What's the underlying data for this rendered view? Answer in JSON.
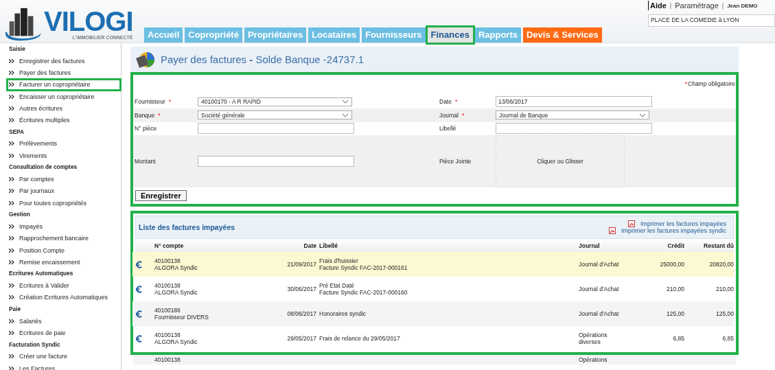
{
  "header": {
    "logo": {
      "name": "VILOGI",
      "tagline": "L'IMMOBILIER CONNECTÉ"
    },
    "links": [
      "Aide",
      "Paramétrage",
      "Jean DEMO"
    ],
    "link_separator": "|",
    "copro_field": {
      "value": "PLACE DE LA COMEDIE à LYON"
    },
    "tabs": [
      {
        "label": "Accueil",
        "kind": "normal",
        "selected": false,
        "highlighted": false
      },
      {
        "label": "Copropriété",
        "kind": "normal",
        "selected": false,
        "highlighted": false
      },
      {
        "label": "Propriétaires",
        "kind": "normal",
        "selected": false,
        "highlighted": false
      },
      {
        "label": "Locataires",
        "kind": "normal",
        "selected": false,
        "highlighted": false
      },
      {
        "label": "Fournisseurs",
        "kind": "normal",
        "selected": false,
        "highlighted": false
      },
      {
        "label": "Finances",
        "kind": "normal",
        "selected": true,
        "highlighted": true
      },
      {
        "label": "Rapports",
        "kind": "normal",
        "selected": false,
        "highlighted": false
      },
      {
        "label": "Devis & Services",
        "kind": "promo",
        "selected": false,
        "highlighted": false
      }
    ]
  },
  "sidebar": [
    {
      "title": "Saisie",
      "items": [
        {
          "label": "Enregistrer des factures",
          "highlighted": false
        },
        {
          "label": "Payer des factures",
          "highlighted": false
        },
        {
          "label": "Facturer un copropriétaire",
          "highlighted": true
        },
        {
          "label": "Encaisser un copropriétaire",
          "highlighted": false
        },
        {
          "label": "Autres écritures",
          "highlighted": false
        },
        {
          "label": "Écritures multiples",
          "highlighted": false
        }
      ]
    },
    {
      "title": "SEPA",
      "items": [
        {
          "label": "Prélèvements",
          "highlighted": false
        },
        {
          "label": "Virements",
          "highlighted": false
        }
      ]
    },
    {
      "title": "Consultation de comptes",
      "items": [
        {
          "label": "Par comptes",
          "highlighted": false
        },
        {
          "label": "Par journaux",
          "highlighted": false
        },
        {
          "label": "Pour toutes copropriétés",
          "highlighted": false
        }
      ]
    },
    {
      "title": "Gestion",
      "items": [
        {
          "label": "Impayés",
          "highlighted": false
        },
        {
          "label": "Rapprochement bancaire",
          "highlighted": false
        },
        {
          "label": "Position Compte",
          "highlighted": false
        },
        {
          "label": "Remise encaissement",
          "highlighted": false
        }
      ]
    },
    {
      "title": "Ecritures Automatiques",
      "items": [
        {
          "label": "Ecritures à Valider",
          "highlighted": false
        },
        {
          "label": "Création Ecritures Automatiques",
          "highlighted": false
        }
      ]
    },
    {
      "title": "Paie",
      "items": [
        {
          "label": "Salariés",
          "highlighted": false
        },
        {
          "label": "Ecritures de paie",
          "highlighted": false
        }
      ]
    },
    {
      "title": "Facturation Syndic",
      "items": [
        {
          "label": "Créer une facture",
          "highlighted": false
        },
        {
          "label": "Les Factures",
          "highlighted": false
        }
      ]
    }
  ],
  "page_title": {
    "main": "Payer des factures",
    "separator": "-",
    "detail": "Solde Banque -24737.1"
  },
  "form": {
    "required_mark": "*",
    "required_note": "Champ obligatoire",
    "rows": [
      {
        "left": {
          "label": "Fournisseur",
          "required": true,
          "kind": "select",
          "value": "40100170 - A R RAPID"
        },
        "right": {
          "label": "Date",
          "required": true,
          "kind": "input",
          "value": "13/06/2017"
        }
      },
      {
        "left": {
          "label": "Banque",
          "required": true,
          "kind": "select",
          "value": "Société générale"
        },
        "right": {
          "label": "Journal",
          "required": true,
          "kind": "select",
          "value": "Journal de Banque"
        }
      },
      {
        "left": {
          "label": "N° pièce",
          "required": false,
          "kind": "input"
        },
        "right": {
          "label": "Libellé",
          "required": false,
          "kind": "input"
        }
      },
      {
        "left": {
          "label": "Montant",
          "required": false,
          "kind": "input"
        },
        "right": {
          "label": "Pièce Jointe",
          "required": false,
          "kind": "drop",
          "value": "Cliquer ou Glisser"
        }
      }
    ],
    "submit": "Enregistrer"
  },
  "invoices": {
    "title": "Liste des factures impayées",
    "print_links": [
      "Imprimer les factures impayées",
      "Imprimer les factures impayées syndic"
    ],
    "columns": [
      "N° compte",
      "Date",
      "Libellé",
      "Journal",
      "Crédit",
      "Restant dû"
    ],
    "rows": [
      {
        "account": [
          "40100138",
          "ALGORA Syndic"
        ],
        "date": "21/09/2017",
        "label": [
          "Frais d'huissier",
          "Facture Syndic FAC-2017-000161"
        ],
        "journal": [
          "Journal d'Achat"
        ],
        "credit": "25000,00",
        "due": "20820,00",
        "highlighted": true
      },
      {
        "account": [
          "40100138",
          "ALGORA Syndic"
        ],
        "date": "30/06/2017",
        "label": [
          "Pré Etat Daté",
          "Facture Syndic FAC-2017-000160"
        ],
        "journal": [
          "Journal d'Achat"
        ],
        "credit": "210,00",
        "due": "210,00",
        "highlighted": false
      },
      {
        "account": [
          "40100186",
          "Fournisseur DIVERS"
        ],
        "date": "08/06/2017",
        "label": [
          "Honoraires syndic"
        ],
        "journal": [
          "Journal d'Achat"
        ],
        "credit": "125,00",
        "due": "125,00",
        "highlighted": false
      },
      {
        "account": [
          "40100138",
          "ALGORA Syndic"
        ],
        "date": "29/05/2017",
        "label": [
          "Frais de relance du 29/05/2017"
        ],
        "journal": [
          "Opérations",
          "diverses"
        ],
        "credit": "6,85",
        "due": "6,85",
        "highlighted": false
      }
    ],
    "partial_row": {
      "account": "40100138",
      "journal": "Opérations"
    }
  }
}
